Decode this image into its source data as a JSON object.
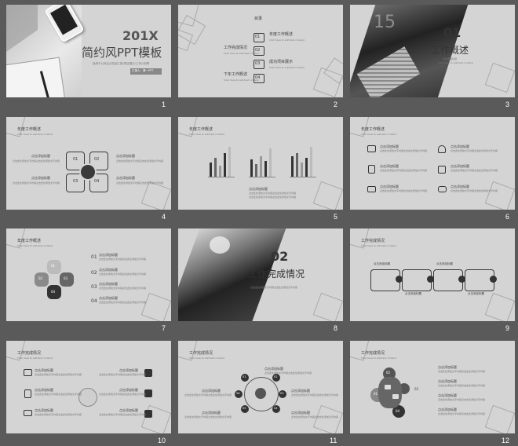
{
  "slide_numbers": [
    "1",
    "2",
    "3",
    "4",
    "5",
    "6",
    "7",
    "8",
    "9",
    "10",
    "11",
    "12"
  ],
  "s1": {
    "year": "201X",
    "title": "简约风PPT模板",
    "subtitle": "适用于公司企业总结汇报/项目展示/工作计划等",
    "reporter": "汇报人：第一PPT"
  },
  "s2": {
    "heading": "目录",
    "items": [
      {
        "n": "01",
        "label": "年度工作概述"
      },
      {
        "n": "02",
        "label": "工作完成情况"
      },
      {
        "n": "03",
        "label": "成功项目展示"
      },
      {
        "n": "04",
        "label": "下年工作概述"
      }
    ]
  },
  "s3": {
    "n": "01",
    "title": "工作概述",
    "phone_text": "15"
  },
  "s4": {
    "heading": "年度工作概述",
    "cells": [
      "01",
      "02",
      "03",
      "04"
    ]
  },
  "s5": {
    "heading": "年度工作概述"
  },
  "s6": {
    "heading": "年度工作概述"
  },
  "s7": {
    "heading": "年度工作概述",
    "nums": [
      "01",
      "02",
      "03",
      "04"
    ],
    "petals": [
      "01",
      "02",
      "03",
      "04"
    ]
  },
  "s8": {
    "n": "02",
    "title": "工作完成情况"
  },
  "s9": {
    "heading": "工作完成情况"
  },
  "s10": {
    "heading": "工作完成情况"
  },
  "s11": {
    "heading": "工作完成情况",
    "nums": [
      "01",
      "02",
      "03",
      "04",
      "05",
      "06"
    ]
  },
  "s12": {
    "heading": "工作完成情况",
    "nums": [
      "01",
      "02",
      "03",
      "04"
    ]
  },
  "text": {
    "label": "点击添加标题",
    "body": "点击此处添加文字内容点击此处添加文字内容",
    "line": "Click here to add text content"
  },
  "colors": {
    "background": "#5a5a5a",
    "slide": "#d4d4d4",
    "dark": "#3a3a3a",
    "mid": "#888888"
  }
}
